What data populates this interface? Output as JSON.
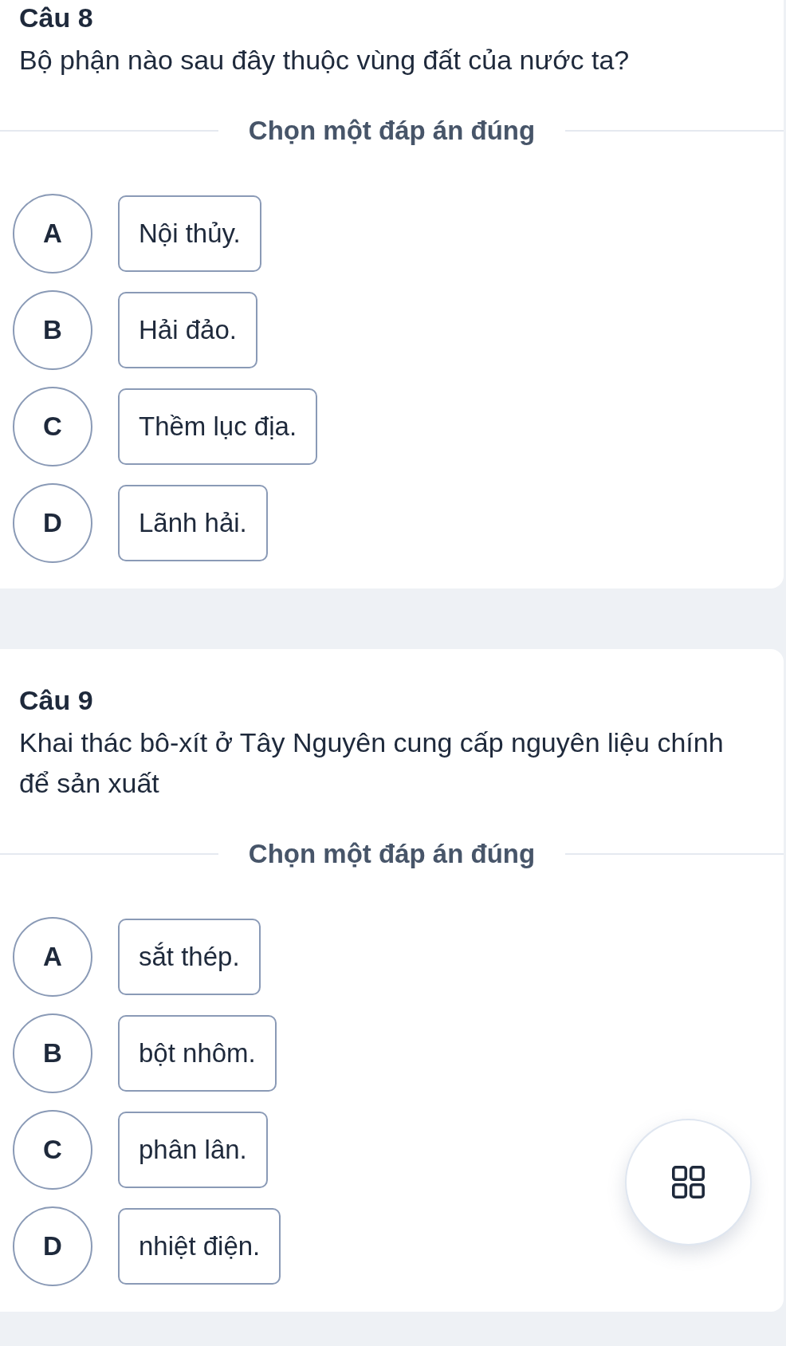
{
  "questions": [
    {
      "title": "Câu 8",
      "text": "Bộ phận nào sau đây thuộc vùng đất của nước ta?",
      "instruction": "Chọn một đáp án đúng",
      "options": [
        {
          "letter": "A",
          "text": "Nội thủy.",
          "selected": false
        },
        {
          "letter": "B",
          "text": "Hải đảo.",
          "selected": false
        },
        {
          "letter": "C",
          "text": "Thềm lục địa.",
          "selected": false
        },
        {
          "letter": "D",
          "text": "Lãnh hải.",
          "selected": false
        }
      ]
    },
    {
      "title": "Câu 9",
      "text": "Khai thác bô-xít ở Tây Nguyên cung cấp nguyên liệu chính để sản xuất",
      "instruction": "Chọn một đáp án đúng",
      "options": [
        {
          "letter": "A",
          "text": "sắt thép.",
          "selected": false
        },
        {
          "letter": "B",
          "text": "bột nhôm.",
          "selected": false
        },
        {
          "letter": "C",
          "text": "phân lân.",
          "selected": false
        },
        {
          "letter": "D",
          "text": "nhiệt điện.",
          "selected": false
        }
      ]
    }
  ]
}
